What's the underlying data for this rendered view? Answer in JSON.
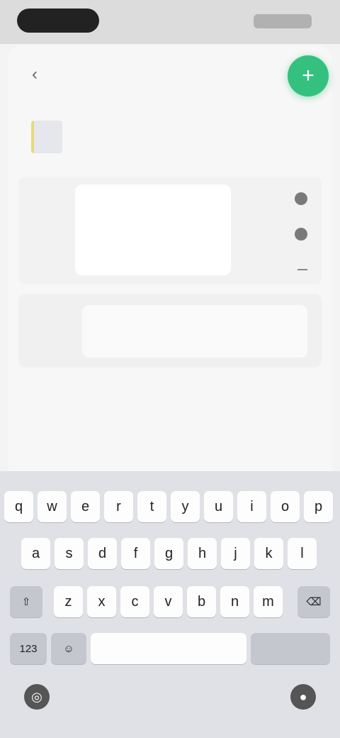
{
  "status_bar": {
    "time": "",
    "indicators": ""
  },
  "nav": {
    "back_icon": "back-chevron-icon",
    "title": "",
    "fab_icon": "plus-icon"
  },
  "document": {
    "name": ""
  },
  "form": {
    "row1_label": "",
    "row2_label": "",
    "row3_label": "",
    "field_value": "",
    "options": [
      {
        "label": ""
      },
      {
        "label": ""
      },
      {
        "label": ""
      }
    ]
  },
  "note": {
    "label": "",
    "label2": "",
    "value": ""
  },
  "keyboard": {
    "row1": [
      "q",
      "w",
      "e",
      "r",
      "t",
      "y",
      "u",
      "i",
      "o",
      "p"
    ],
    "row2": [
      "a",
      "s",
      "d",
      "f",
      "g",
      "h",
      "j",
      "k",
      "l"
    ],
    "row3": [
      "z",
      "x",
      "c",
      "v",
      "b",
      "n",
      "m"
    ],
    "shift_icon": "shift-icon",
    "delete_icon": "backspace-icon",
    "numbers_label": "123",
    "emoji_icon": "emoji-icon",
    "space_label": "",
    "return_label": "",
    "globe_icon": "globe-icon",
    "mic_icon": "microphone-icon"
  },
  "colors": {
    "accent": "#34c17f",
    "keyboard_bg": "#dfe1e6"
  }
}
